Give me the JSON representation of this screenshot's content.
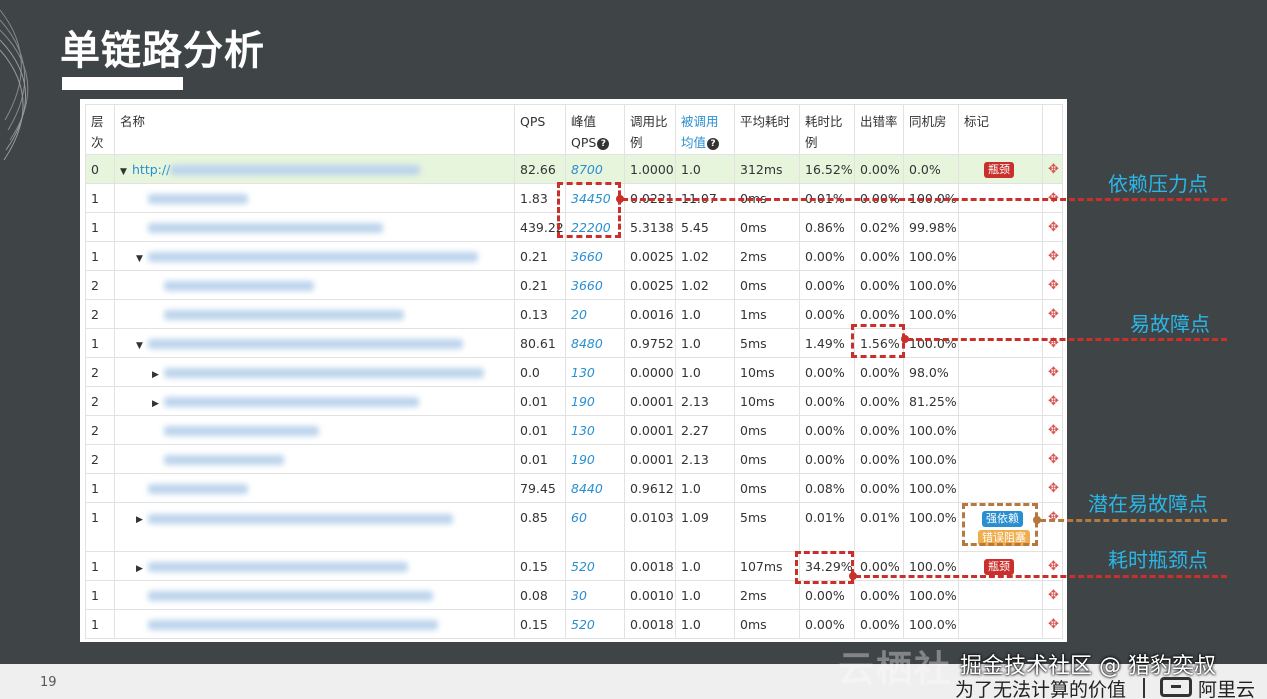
{
  "slide": {
    "title": "单链路分析",
    "page_number": "19"
  },
  "table": {
    "headers": [
      {
        "label": "层次"
      },
      {
        "label": "名称"
      },
      {
        "label": "QPS"
      },
      {
        "label": "峰值QPS"
      },
      {
        "label": "调用比例"
      },
      {
        "label": "被调用均值"
      },
      {
        "label": "平均耗时"
      },
      {
        "label": "耗时比例"
      },
      {
        "label": "出错率"
      },
      {
        "label": "同机房"
      },
      {
        "label": "标记"
      }
    ],
    "rows": [
      {
        "level": "0",
        "name": "http://",
        "qps": "82.66",
        "peak": "8700",
        "ratio": "1.0000",
        "mean": "1.0",
        "avg": "312ms",
        "tr": "16.52%",
        "err": "0.00%",
        "same": "0.0%"
      },
      {
        "level": "1",
        "qps": "1.83",
        "peak": "34450",
        "ratio": "0.0221",
        "mean": "11.07",
        "avg": "0ms",
        "tr": "0.01%",
        "err": "0.00%",
        "same": "100.0%"
      },
      {
        "level": "1",
        "qps": "439.22",
        "peak": "22200",
        "ratio": "5.3138",
        "mean": "5.45",
        "avg": "0ms",
        "tr": "0.86%",
        "err": "0.02%",
        "same": "99.98%"
      },
      {
        "level": "1",
        "qps": "0.21",
        "peak": "3660",
        "ratio": "0.0025",
        "mean": "1.02",
        "avg": "2ms",
        "tr": "0.00%",
        "err": "0.00%",
        "same": "100.0%"
      },
      {
        "level": "2",
        "qps": "0.21",
        "peak": "3660",
        "ratio": "0.0025",
        "mean": "1.02",
        "avg": "0ms",
        "tr": "0.00%",
        "err": "0.00%",
        "same": "100.0%"
      },
      {
        "level": "2",
        "qps": "0.13",
        "peak": "20",
        "ratio": "0.0016",
        "mean": "1.0",
        "avg": "1ms",
        "tr": "0.00%",
        "err": "0.00%",
        "same": "100.0%"
      },
      {
        "level": "1",
        "qps": "80.61",
        "peak": "8480",
        "ratio": "0.9752",
        "mean": "1.0",
        "avg": "5ms",
        "tr": "1.49%",
        "err": "1.56%",
        "same": "100.0%"
      },
      {
        "level": "2",
        "qps": "0.0",
        "peak": "130",
        "ratio": "0.0000",
        "mean": "1.0",
        "avg": "10ms",
        "tr": "0.00%",
        "err": "0.00%",
        "same": "98.0%"
      },
      {
        "level": "2",
        "qps": "0.01",
        "peak": "190",
        "ratio": "0.0001",
        "mean": "2.13",
        "avg": "10ms",
        "tr": "0.00%",
        "err": "0.00%",
        "same": "81.25%"
      },
      {
        "level": "2",
        "qps": "0.01",
        "peak": "130",
        "ratio": "0.0001",
        "mean": "2.27",
        "avg": "0ms",
        "tr": "0.00%",
        "err": "0.00%",
        "same": "100.0%"
      },
      {
        "level": "2",
        "qps": "0.01",
        "peak": "190",
        "ratio": "0.0001",
        "mean": "2.13",
        "avg": "0ms",
        "tr": "0.00%",
        "err": "0.00%",
        "same": "100.0%"
      },
      {
        "level": "1",
        "qps": "79.45",
        "peak": "8440",
        "ratio": "0.9612",
        "mean": "1.0",
        "avg": "0ms",
        "tr": "0.08%",
        "err": "0.00%",
        "same": "100.0%"
      },
      {
        "level": "1",
        "qps": "0.85",
        "peak": "60",
        "ratio": "0.0103",
        "mean": "1.09",
        "avg": "5ms",
        "tr": "0.01%",
        "err": "0.01%",
        "same": "100.0%"
      },
      {
        "level": "1",
        "qps": "0.15",
        "peak": "520",
        "ratio": "0.0018",
        "mean": "1.0",
        "avg": "107ms",
        "tr": "34.29%",
        "err": "0.00%",
        "same": "100.0%"
      },
      {
        "level": "1",
        "qps": "0.08",
        "peak": "30",
        "ratio": "0.0010",
        "mean": "1.0",
        "avg": "2ms",
        "tr": "0.00%",
        "err": "0.00%",
        "same": "100.0%"
      },
      {
        "level": "1",
        "qps": "0.15",
        "peak": "520",
        "ratio": "0.0018",
        "mean": "1.0",
        "avg": "0ms",
        "tr": "0.00%",
        "err": "0.00%",
        "same": "100.0%"
      }
    ],
    "badges": {
      "bottleneck": "瓶颈",
      "strong_dep": "强依赖",
      "error_block": "错误阻塞"
    }
  },
  "annotations": {
    "pressure_point": "依赖压力点",
    "fault_prone": "易故障点",
    "potential_fault": "潜在易故障点",
    "latency_bottleneck": "耗时瓶颈点"
  },
  "colors": {
    "slide_bg": "#3f4447",
    "accent_blue": "#2ab7e8",
    "highlight_red": "#c9302c",
    "highlight_brown": "#b5793f",
    "link_blue": "#2a8fd0",
    "row_highlight": "#e7f5dd"
  },
  "footer": {
    "watermark_big": "云栖社",
    "watermark": "掘金技术社区 @ 猎豹奕叔",
    "tagline": "为了无法计算的价值",
    "logo_text": "阿里云"
  }
}
